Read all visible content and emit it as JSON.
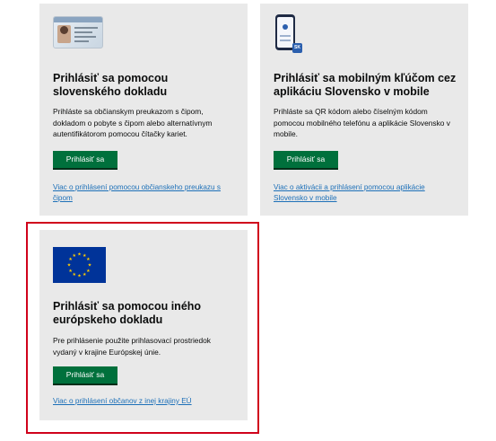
{
  "cards": [
    {
      "id": "eid",
      "title": "Prihlásiť sa pomocou slovenského dokladu",
      "description": "Prihláste sa občianskym preukazom s čipom, dokladom o pobyte s čipom alebo alternatívnym autentifikátorom pomocou čítačky kariet.",
      "button_label": "Prihlásiť sa",
      "link_text": "Viac o prihlásení pomocou občianskeho preukazu s čipom",
      "image_icon": "id-card-icon"
    },
    {
      "id": "mobile",
      "title": "Prihlásiť sa mobilným kľúčom cez aplikáciu Slovensko v mobile",
      "description": "Prihláste sa QR kódom alebo číselným kódom pomocou mobilného telefónu a aplikácie Slovensko v mobile.",
      "button_label": "Prihlásiť sa",
      "link_text": "Viac o aktivácii a prihlásení pomocou aplikácie Slovensko v mobile",
      "image_icon": "mobile-phone-icon",
      "badge_text": "SK"
    },
    {
      "id": "eu",
      "title": "Prihlásiť sa pomocou iného európskeho dokladu",
      "description": "Pre prihlásenie použite prihlasovací prostriedok vydaný v krajine Európskej únie.",
      "button_label": "Prihlásiť sa",
      "link_text": "Viac o prihlásení občanov z inej krajiny EÚ",
      "image_icon": "eu-flag-icon"
    }
  ],
  "colors": {
    "card_bg": "#e9e9e9",
    "button": "#00703c",
    "link": "#1d70b8",
    "highlight": "#d0021b",
    "eu_blue": "#003399",
    "eu_star": "#ffcc00"
  }
}
